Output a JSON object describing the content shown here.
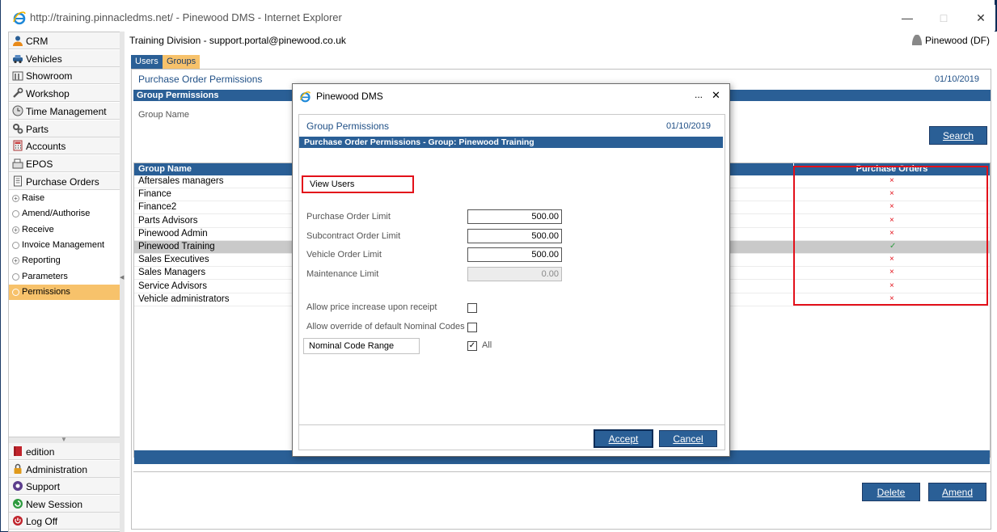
{
  "browser": {
    "title": "http://training.pinnacledms.net/ - Pinewood DMS - Internet Explorer"
  },
  "sidebar": {
    "top_items": [
      {
        "label": "CRM",
        "icon": "person-icon"
      },
      {
        "label": "Vehicles",
        "icon": "car-icon"
      },
      {
        "label": "Showroom",
        "icon": "showroom-icon"
      },
      {
        "label": "Workshop",
        "icon": "wrench-icon"
      },
      {
        "label": "Time Management",
        "icon": "clock-icon"
      },
      {
        "label": "Parts",
        "icon": "gears-icon"
      },
      {
        "label": "Accounts",
        "icon": "calculator-icon"
      },
      {
        "label": "EPOS",
        "icon": "register-icon"
      },
      {
        "label": "Purchase Orders",
        "icon": "document-icon"
      }
    ],
    "sub_items": [
      {
        "label": "Raise",
        "expandable": true,
        "active": false
      },
      {
        "label": "Amend/Authorise",
        "expandable": false,
        "active": false
      },
      {
        "label": "Receive",
        "expandable": true,
        "active": false
      },
      {
        "label": "Invoice Management",
        "expandable": false,
        "active": false
      },
      {
        "label": "Reporting",
        "expandable": true,
        "active": false
      },
      {
        "label": "Parameters",
        "expandable": false,
        "active": false
      },
      {
        "label": "Permissions",
        "expandable": false,
        "active": true
      }
    ],
    "bottom_items": [
      {
        "label": "edition",
        "icon": "book-icon"
      },
      {
        "label": "Administration",
        "icon": "lock-icon"
      },
      {
        "label": "Support",
        "icon": "support-icon"
      },
      {
        "label": "New Session",
        "icon": "new-session-icon"
      },
      {
        "label": "Log Off",
        "icon": "power-icon"
      }
    ]
  },
  "header": {
    "title": "Training Division - support.portal@pinewood.co.uk",
    "user": "Pinewood (DF)"
  },
  "tabs": [
    {
      "label": "Users"
    },
    {
      "label": "Groups"
    }
  ],
  "panel": {
    "title": "Purchase Order Permissions",
    "date": "01/10/2019",
    "section": "Group Permissions",
    "group_name_label": "Group Name",
    "search_label": "Search",
    "delete_label": "Delete",
    "amend_label": "Amend"
  },
  "grid": {
    "columns": [
      "Group Name",
      "Purchase Orders"
    ],
    "rows": [
      {
        "name": "Aftersales managers",
        "allowed": false
      },
      {
        "name": "Finance",
        "allowed": false
      },
      {
        "name": "Finance2",
        "allowed": false
      },
      {
        "name": "Parts Advisors",
        "allowed": false
      },
      {
        "name": "Pinewood Admin",
        "allowed": false
      },
      {
        "name": "Pinewood Training",
        "allowed": true
      },
      {
        "name": "Sales Executives",
        "allowed": false
      },
      {
        "name": "Sales Managers",
        "allowed": false
      },
      {
        "name": "Service Advisors",
        "allowed": false
      },
      {
        "name": "Vehicle administrators",
        "allowed": false
      }
    ],
    "cross_mark": "×",
    "check_mark": "✓"
  },
  "dialog": {
    "title": "Pinewood DMS",
    "more": "...",
    "close": "✕",
    "heading": "Group Permissions",
    "date": "01/10/2019",
    "subheading": "Purchase Order Permissions - Group: Pinewood Training",
    "view_users_label": "View Users",
    "limits": [
      {
        "label": "Purchase Order Limit",
        "value": "500.00",
        "disabled": false
      },
      {
        "label": "Subcontract Order Limit",
        "value": "500.00",
        "disabled": false
      },
      {
        "label": "Vehicle Order Limit",
        "value": "500.00",
        "disabled": false
      },
      {
        "label": "Maintenance Limit",
        "value": "0.00",
        "disabled": true
      }
    ],
    "allow_price_increase_label": "Allow price increase upon receipt",
    "allow_price_increase": false,
    "allow_override_label": "Allow override of default Nominal Codes",
    "allow_override": false,
    "nominal_range_label": "Nominal Code Range",
    "all_label": "All",
    "all_checked": true,
    "accept_label": "Accept",
    "cancel_label": "Cancel"
  }
}
